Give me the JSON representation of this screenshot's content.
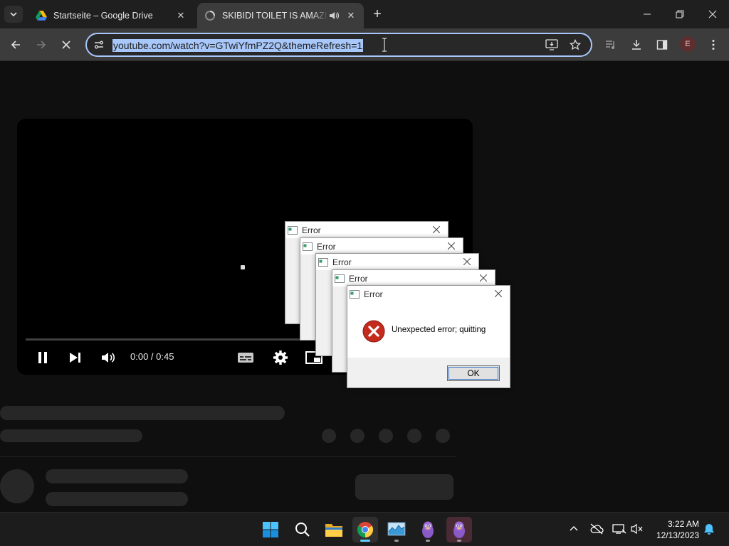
{
  "browser": {
    "tabs": [
      {
        "title": "Startseite – Google Drive",
        "icon": "google-drive-icon",
        "active": false
      },
      {
        "title": "SKIBIDI TOILET IS AMAZING",
        "icon": "loading-spinner-icon",
        "active": true,
        "audio": true
      }
    ],
    "address": "youtube.com/watch?v=GTwiYfmPZ2Q&themeRefresh=1",
    "profile_initial": "E",
    "colors": {
      "accent": "#a8c7fa",
      "toolbar": "#3c3c3c",
      "tabstrip": "#1f1f1f"
    }
  },
  "player": {
    "time": "0:00 / 0:45",
    "progress": 0
  },
  "dialogs": [
    {
      "title": "Error"
    },
    {
      "title": "Error"
    },
    {
      "title": "Error"
    },
    {
      "title": "Error"
    },
    {
      "title": "Error",
      "message": "Unexpected error; quitting",
      "button": "OK"
    }
  ],
  "taskbar": {
    "apps": [
      "windows-start-icon",
      "search-icon",
      "file-explorer-icon",
      "chrome-icon",
      "task-manager-icon",
      "bonzi-icon",
      "bonzi-icon"
    ],
    "time": "3:22 AM",
    "date": "12/13/2023"
  }
}
